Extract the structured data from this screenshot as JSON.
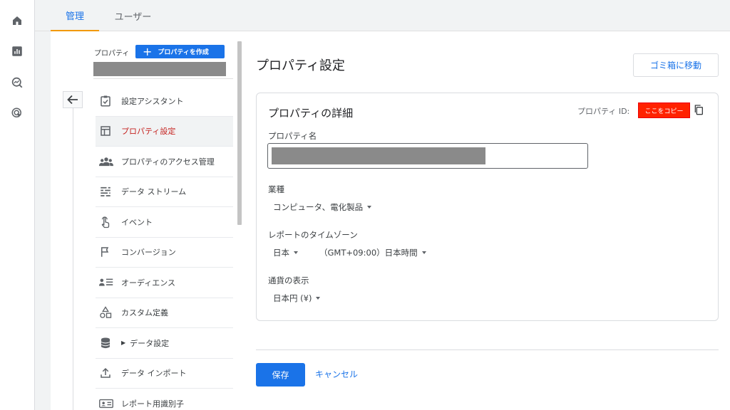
{
  "tabs": [
    {
      "label": "管理",
      "active": true
    },
    {
      "label": "ユーザー",
      "active": false
    }
  ],
  "rail": [
    "home-icon",
    "reports-icon",
    "explore-icon",
    "advertising-icon"
  ],
  "sidebar": {
    "property_label": "プロパティ",
    "create_label": "プロパティを作成",
    "items": [
      {
        "label": "設定アシスタント",
        "icon": "checklist-icon"
      },
      {
        "label": "プロパティ設定",
        "icon": "layout-icon",
        "active": true
      },
      {
        "label": "プロパティのアクセス管理",
        "icon": "people-icon"
      },
      {
        "label": "データ ストリーム",
        "icon": "streams-icon"
      },
      {
        "label": "イベント",
        "icon": "touch-icon"
      },
      {
        "label": "コンバージョン",
        "icon": "flag-icon"
      },
      {
        "label": "オーディエンス",
        "icon": "audience-icon"
      },
      {
        "label": "カスタム定義",
        "icon": "shapes-icon"
      },
      {
        "label": "データ設定",
        "icon": "database-icon",
        "expandable": true
      },
      {
        "label": "データ インポート",
        "icon": "upload-icon"
      },
      {
        "label": "レポート用識別子",
        "icon": "id-icon"
      }
    ]
  },
  "main": {
    "title": "プロパティ設定",
    "trash_label": "ゴミ箱に移動",
    "card_title": "プロパティの詳細",
    "property_id_label": "プロパティ ID:",
    "property_id_value": "ここをコピー",
    "name_label": "プロパティ名",
    "industry_label": "業種",
    "industry_value": "コンピュータ、電化製品",
    "tz_label": "レポートのタイムゾーン",
    "tz_country": "日本",
    "tz_value": "（GMT+09:00）日本時間",
    "currency_label": "通貨の表示",
    "currency_value": "日本円 (¥)",
    "save_label": "保存",
    "cancel_label": "キャンセル"
  },
  "colors": {
    "accent": "#1a73e8",
    "active_item": "#c5221f",
    "tab_underline": "#f29900",
    "highlight": "#ff2200"
  }
}
